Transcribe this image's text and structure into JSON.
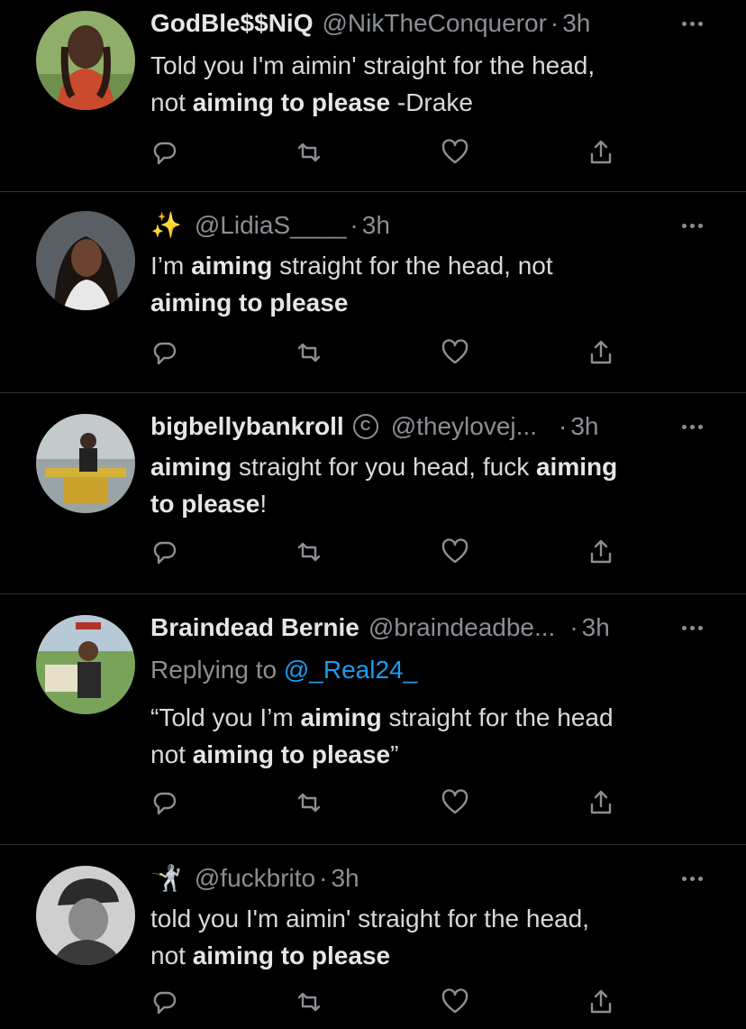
{
  "tweets": [
    {
      "name": "GodBle$$NiQ",
      "handle": "@NikTheConqueror",
      "time": "3h",
      "body": [
        {
          "t": "Told you I'm aimin' straight for the head,",
          "b": false
        },
        {
          "t": "\n",
          "b": false
        },
        {
          "t": "not ",
          "b": false
        },
        {
          "t": "aiming to please",
          "b": true
        },
        {
          "t": " -Drake",
          "b": false
        }
      ]
    },
    {
      "emoji": "✨",
      "handle": "@LidiaS____",
      "time": "3h",
      "body": [
        {
          "t": "I’m ",
          "b": false
        },
        {
          "t": "aiming",
          "b": true
        },
        {
          "t": " straight for the head, not",
          "b": false
        },
        {
          "t": "\n",
          "b": false
        },
        {
          "t": "aiming to please",
          "b": true
        }
      ]
    },
    {
      "name": "bigbellybankroll",
      "verified_glyph": "C",
      "handle": "@theylovej...",
      "time": "3h",
      "body": [
        {
          "t": "aiming",
          "b": true
        },
        {
          "t": " straight for you head, fuck ",
          "b": false
        },
        {
          "t": "aiming",
          "b": true
        },
        {
          "t": "\n",
          "b": false
        },
        {
          "t": "to please",
          "b": true
        },
        {
          "t": "!",
          "b": false
        }
      ]
    },
    {
      "name": "Braindead Bernie",
      "handle": "@braindeadbe...",
      "time": "3h",
      "reply_prefix": "Replying to ",
      "reply_mention": "@_Real24_",
      "body": [
        {
          "t": "“Told you I’m ",
          "b": false
        },
        {
          "t": "aiming",
          "b": true
        },
        {
          "t": " straight for the head",
          "b": false
        },
        {
          "t": "\n",
          "b": false
        },
        {
          "t": "not ",
          "b": false
        },
        {
          "t": "aiming to please",
          "b": true
        },
        {
          "t": "”",
          "b": false
        }
      ]
    },
    {
      "emoji": "🤺",
      "handle": "@fuckbrito",
      "time": "3h",
      "body": [
        {
          "t": "told you I'm aimin' straight for the head,",
          "b": false
        },
        {
          "t": "\n",
          "b": false
        },
        {
          "t": "not ",
          "b": false
        },
        {
          "t": "aiming to please",
          "b": true
        }
      ]
    }
  ],
  "separator": "·",
  "icons": [
    "reply-icon",
    "retweet-icon",
    "like-icon",
    "share-icon",
    "more-icon"
  ],
  "colors": {
    "background": "#000000",
    "text": "#d9d9d9",
    "muted": "#8b8f94",
    "link": "#1d9bf0",
    "divider": "#2f3336"
  }
}
